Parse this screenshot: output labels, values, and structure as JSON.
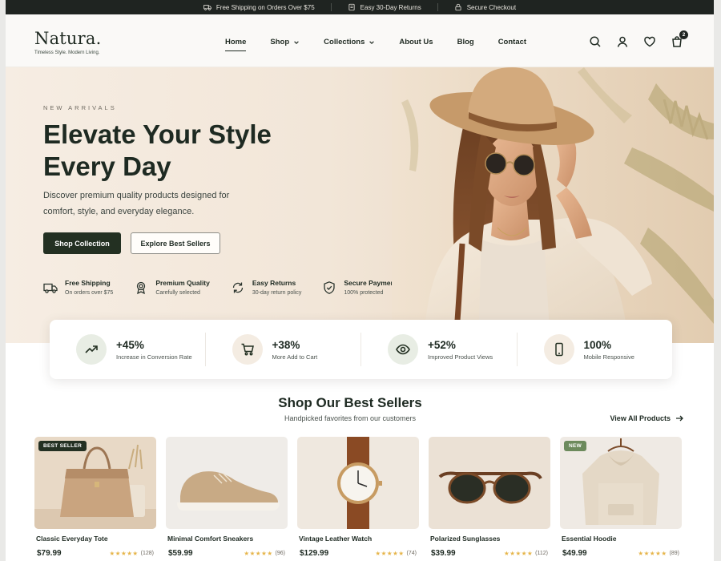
{
  "topbar": {
    "items": [
      {
        "icon": "truck-icon",
        "text": "Free Shipping on Orders Over $75"
      },
      {
        "icon": "return-icon",
        "text": "Easy 30-Day Returns"
      },
      {
        "icon": "lock-icon",
        "text": "Secure Checkout"
      }
    ]
  },
  "header": {
    "logo": "Natura.",
    "tagline": "Timeless Style. Modern Living.",
    "nav": [
      {
        "label": "Home",
        "active": true
      },
      {
        "label": "Shop",
        "dropdown": true
      },
      {
        "label": "Collections",
        "dropdown": true
      },
      {
        "label": "About Us"
      },
      {
        "label": "Blog"
      },
      {
        "label": "Contact"
      }
    ],
    "cart_count": "2",
    "icons": [
      "search-icon",
      "user-icon",
      "heart-icon",
      "cart-icon"
    ]
  },
  "hero": {
    "eyebrow": "NEW ARRIVALS",
    "title_line1": "Elevate Your Style",
    "title_line2": "Every Day",
    "subtitle": "Discover premium quality products designed for comfort, style, and everyday elegance.",
    "primary_cta": "Shop Collection",
    "secondary_cta": "Explore Best Sellers",
    "features": [
      {
        "icon": "truck-icon",
        "title": "Free Shipping",
        "sub": "On orders over $75"
      },
      {
        "icon": "award-icon",
        "title": "Premium Quality",
        "sub": "Carefully selected"
      },
      {
        "icon": "refresh-icon",
        "title": "Easy Returns",
        "sub": "30-day return policy"
      },
      {
        "icon": "shield-icon",
        "title": "Secure Payments",
        "sub": "100% protected"
      }
    ]
  },
  "stats": [
    {
      "icon": "trending-up-icon",
      "value": "+45%",
      "label": "Increase in Conversion Rate",
      "bg": "#e8ede4"
    },
    {
      "icon": "cart-icon",
      "value": "+38%",
      "label": "More Add to Cart",
      "bg": "#f4ece2"
    },
    {
      "icon": "eye-icon",
      "value": "+52%",
      "label": "Improved Product Views",
      "bg": "#e8ede4"
    },
    {
      "icon": "mobile-icon",
      "value": "100%",
      "label": "Mobile Responsive",
      "bg": "#f4ece2"
    }
  ],
  "best_sellers": {
    "title": "Shop Our Best Sellers",
    "subtitle": "Handpicked favorites from our customers",
    "view_all": "View All Products",
    "products": [
      {
        "name": "Classic Everyday Tote",
        "price": "$79.99",
        "stars": "★★★★★",
        "reviews": "(128)",
        "badge": "BEST SELLER",
        "badge_color": "#233022"
      },
      {
        "name": "Minimal Comfort Sneakers",
        "price": "$59.99",
        "stars": "★★★★★",
        "reviews": "(96)",
        "badge": "",
        "badge_color": ""
      },
      {
        "name": "Vintage Leather Watch",
        "price": "$129.99",
        "stars": "★★★★★",
        "reviews": "(74)",
        "badge": "",
        "badge_color": ""
      },
      {
        "name": "Polarized Sunglasses",
        "price": "$39.99",
        "stars": "★★★★★",
        "reviews": "(112)",
        "badge": "",
        "badge_color": ""
      },
      {
        "name": "Essential Hoodie",
        "price": "$49.99",
        "stars": "★★★★★",
        "reviews": "(89)",
        "badge": "NEW",
        "badge_color": "#6c8a5c"
      }
    ]
  },
  "colors": {
    "accent_dark": "#233022",
    "star": "#e6b54a",
    "hero_bg": "#f2e6d8"
  }
}
